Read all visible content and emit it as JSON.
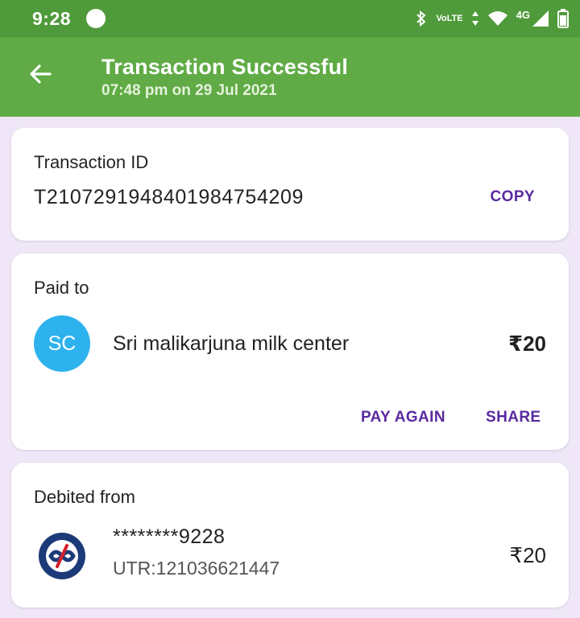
{
  "colors": {
    "status_bar": "#4f9a3a",
    "app_bar": "#60ab45",
    "background": "#efe7f7",
    "accent": "#5a2aa0",
    "avatar": "#2eb2ee",
    "bank_logo_blue": "#1d3a78",
    "bank_logo_red": "#d61e2b"
  },
  "status_bar": {
    "time": "9:28",
    "volte_top": "Vo",
    "volte_bottom": "LTE",
    "network": "4G",
    "icons": [
      "record-dot-icon",
      "bluetooth-icon",
      "volte-icon",
      "data-arrows-icon",
      "wifi-icon",
      "signal-icon",
      "battery-icon"
    ]
  },
  "app_bar": {
    "back_icon": "arrow-back-icon",
    "title": "Transaction Successful",
    "subtitle": "07:48 pm on 29 Jul 2021"
  },
  "transaction": {
    "label": "Transaction ID",
    "id": "T2107291948401984754209",
    "copy_label": "COPY"
  },
  "paid_to": {
    "label": "Paid to",
    "avatar_initials": "SC",
    "name": "Sri malikarjuna milk center",
    "amount": "₹20",
    "pay_again_label": "PAY AGAIN",
    "share_label": "SHARE"
  },
  "debited_from": {
    "label": "Debited from",
    "bank_icon": "kotak-bank-logo-icon",
    "account": "********9228",
    "utr": "UTR:121036621447",
    "amount": "₹20"
  }
}
